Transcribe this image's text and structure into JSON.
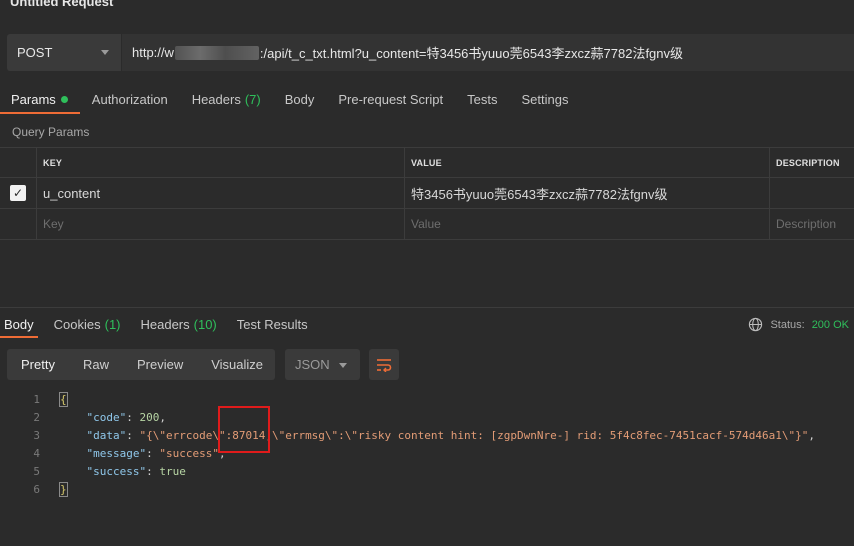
{
  "window": {
    "title": "Untitled Request"
  },
  "request": {
    "method": "POST",
    "url_prefix": "http://w",
    "url_suffix": ":/api/t_c_txt.html?u_content=特3456书yuuo莞6543李zxcz蒜7782法fgnv级"
  },
  "request_tabs": [
    {
      "label": "Params",
      "active": true,
      "indicator": "dot"
    },
    {
      "label": "Authorization"
    },
    {
      "label": "Headers",
      "count": "(7)"
    },
    {
      "label": "Body"
    },
    {
      "label": "Pre-request Script"
    },
    {
      "label": "Tests"
    },
    {
      "label": "Settings"
    }
  ],
  "params": {
    "section_label": "Query Params",
    "headers": {
      "key": "KEY",
      "value": "VALUE",
      "description": "DESCRIPTION"
    },
    "rows": [
      {
        "checked": true,
        "key": "u_content",
        "value": "特3456书yuuo莞6543李zxcz蒜7782法fgnv级",
        "description": ""
      }
    ],
    "placeholder": {
      "key": "Key",
      "value": "Value",
      "description": "Description"
    }
  },
  "response_tabs": [
    {
      "label": "Body",
      "active": true
    },
    {
      "label": "Cookies",
      "count": "(1)"
    },
    {
      "label": "Headers",
      "count": "(10)"
    },
    {
      "label": "Test Results"
    }
  ],
  "status": {
    "label": "Status:",
    "value": "200 OK",
    "color": "#2fbf5b"
  },
  "view_modes": [
    "Pretty",
    "Raw",
    "Preview",
    "Visualize"
  ],
  "active_view": "Pretty",
  "format": "JSON",
  "code_lines": [
    {
      "num": "1",
      "parts": [
        [
          "b",
          "{"
        ]
      ]
    },
    {
      "num": "2",
      "parts": [
        [
          "p",
          "    "
        ],
        [
          "k",
          "\"code\""
        ],
        [
          "p",
          ": "
        ],
        [
          "n",
          "200"
        ],
        [
          "p",
          ","
        ]
      ]
    },
    {
      "num": "3",
      "parts": [
        [
          "p",
          "    "
        ],
        [
          "k",
          "\"data\""
        ],
        [
          "p",
          ": "
        ],
        [
          "s",
          "\"{\\\"errcode\\\":87014,\\\"errmsg\\\":\\\"risky content hint: [zgpDwnNre-] rid: 5f4c8fec-7451cacf-574d46a1\\\"}\""
        ],
        [
          "p",
          ","
        ]
      ]
    },
    {
      "num": "4",
      "parts": [
        [
          "p",
          "    "
        ],
        [
          "k",
          "\"message\""
        ],
        [
          "p",
          ": "
        ],
        [
          "s",
          "\"success\""
        ],
        [
          "p",
          ","
        ]
      ]
    },
    {
      "num": "5",
      "parts": [
        [
          "p",
          "    "
        ],
        [
          "k",
          "\"success\""
        ],
        [
          "p",
          ": "
        ],
        [
          "n",
          "true"
        ]
      ]
    },
    {
      "num": "6",
      "parts": [
        [
          "b",
          "}"
        ]
      ]
    }
  ],
  "colors": {
    "accent": "#ef6c36",
    "success": "#2fbf5b",
    "highlight_box": "#e01b1b"
  }
}
